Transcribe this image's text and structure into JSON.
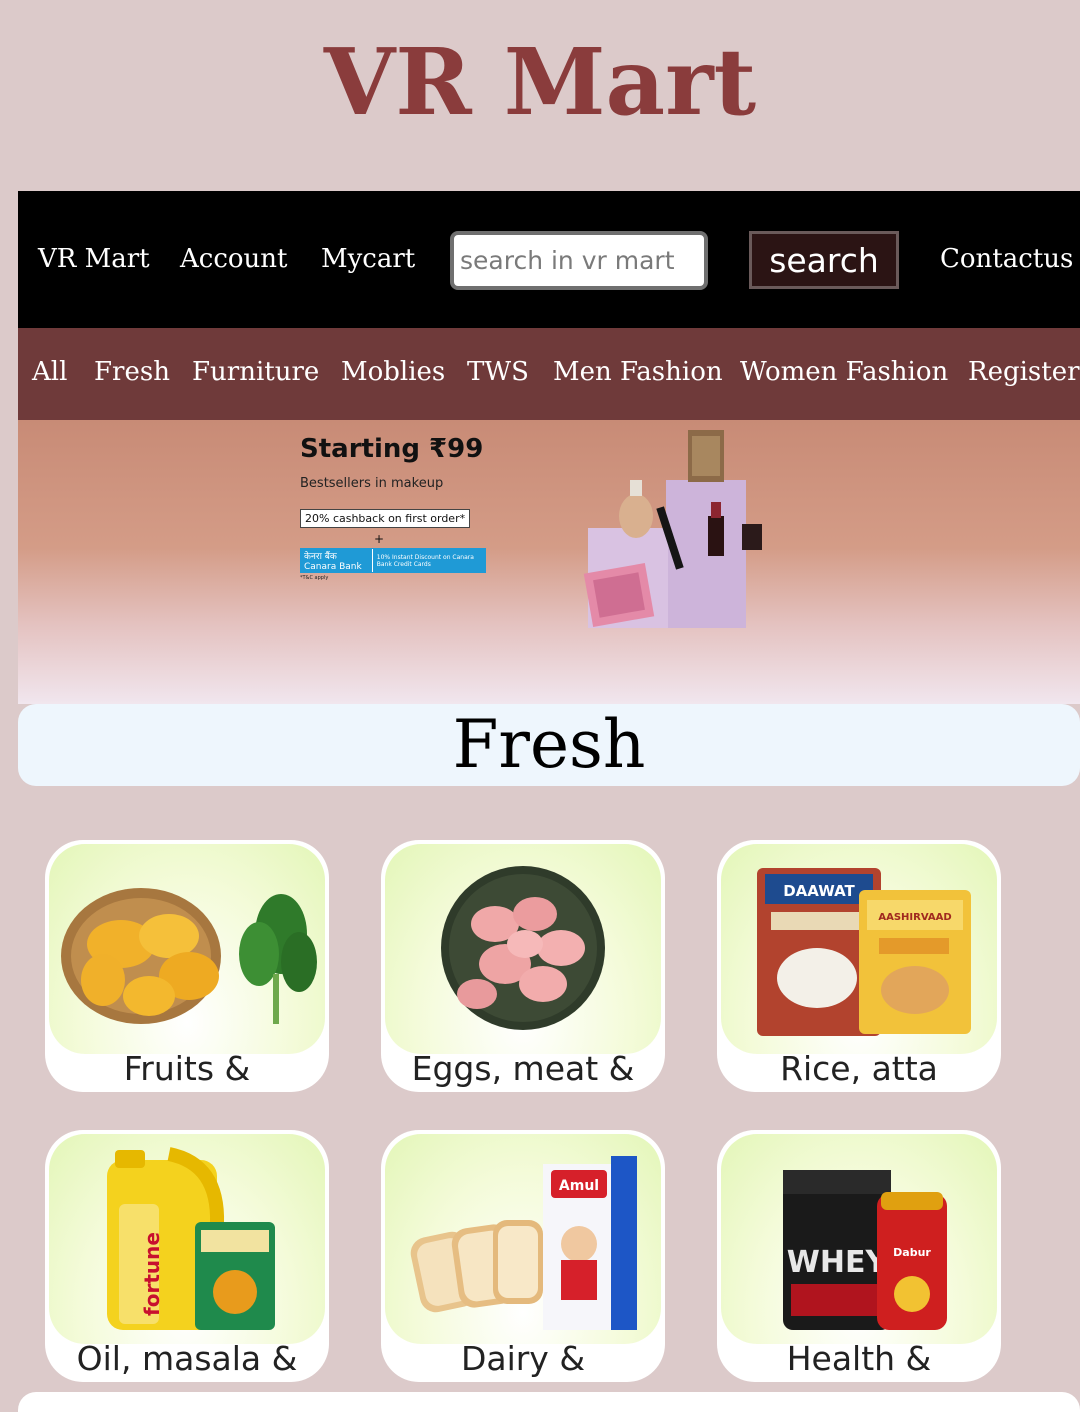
{
  "header": {
    "site_title": "VR Mart"
  },
  "navbar": {
    "brand": "VR Mart",
    "account": "Account",
    "cart": "Mycart",
    "search_placeholder": "search in vr mart",
    "search_button": "search",
    "contact": "Contactus"
  },
  "categories": [
    "All",
    "Fresh",
    "Furniture",
    "Moblies",
    "TWS",
    "Men Fashion",
    "Women Fashion",
    "Register"
  ],
  "banner": {
    "headline": "Starting ₹99",
    "subtext": "Bestsellers in makeup",
    "offer": "20% cashback on first order*",
    "plus": "+",
    "bank_name": "केनरा बैंक Canara Bank",
    "bank_discount": "10% Instant Discount on Canara Bank Credit Cards",
    "terms": "*T&C apply"
  },
  "section": {
    "title": "Fresh"
  },
  "cards": [
    {
      "label": "Fruits &",
      "image": "mangoes-spinach-image"
    },
    {
      "label": "Eggs, meat &",
      "image": "chicken-meat-image"
    },
    {
      "label": "Rice, atta",
      "image": "rice-atta-image"
    },
    {
      "label": "Oil, masala &",
      "image": "oil-masala-image"
    },
    {
      "label": "Dairy &",
      "image": "bread-milk-image"
    },
    {
      "label": "Health &",
      "image": "whey-chyawanprash-image"
    }
  ],
  "colors": {
    "page_bg": "#dccaca",
    "title": "#8a3c3c",
    "navbar_bg": "#000000",
    "catbar_bg": "#6f3a3a",
    "section_bg": "#eef6fd",
    "search_button_bg": "#2b1414"
  }
}
